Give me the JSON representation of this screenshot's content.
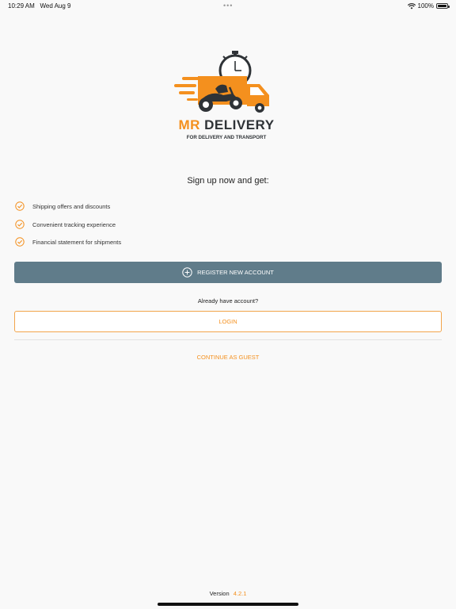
{
  "status_bar": {
    "time": "10:29 AM",
    "date": "Wed Aug 9",
    "battery": "100%"
  },
  "logo": {
    "title_prefix": "MR",
    "title_rest": " DELIVERY",
    "subtitle": "FOR DELIVERY AND TRANSPORT",
    "accent_color": "#f4901e"
  },
  "headline": "Sign up now and get:",
  "benefits": [
    "Shipping offers and discounts",
    "Convenient tracking experience",
    "Financial statement for shipments"
  ],
  "register_button": "REGISTER NEW ACCOUNT",
  "already_text": "Already have account?",
  "login_button": "LOGIN",
  "guest_link": "CONTINUE AS GUEST",
  "version": {
    "label": "Version",
    "number": "4.2.1"
  },
  "colors": {
    "primary_button": "#607c8a",
    "accent": "#f4901e",
    "background": "#f9f9f9"
  },
  "icons": {
    "benefit": "check-circle-icon",
    "register": "plus-circle-icon",
    "status": [
      "wifi-icon",
      "battery-icon"
    ]
  }
}
